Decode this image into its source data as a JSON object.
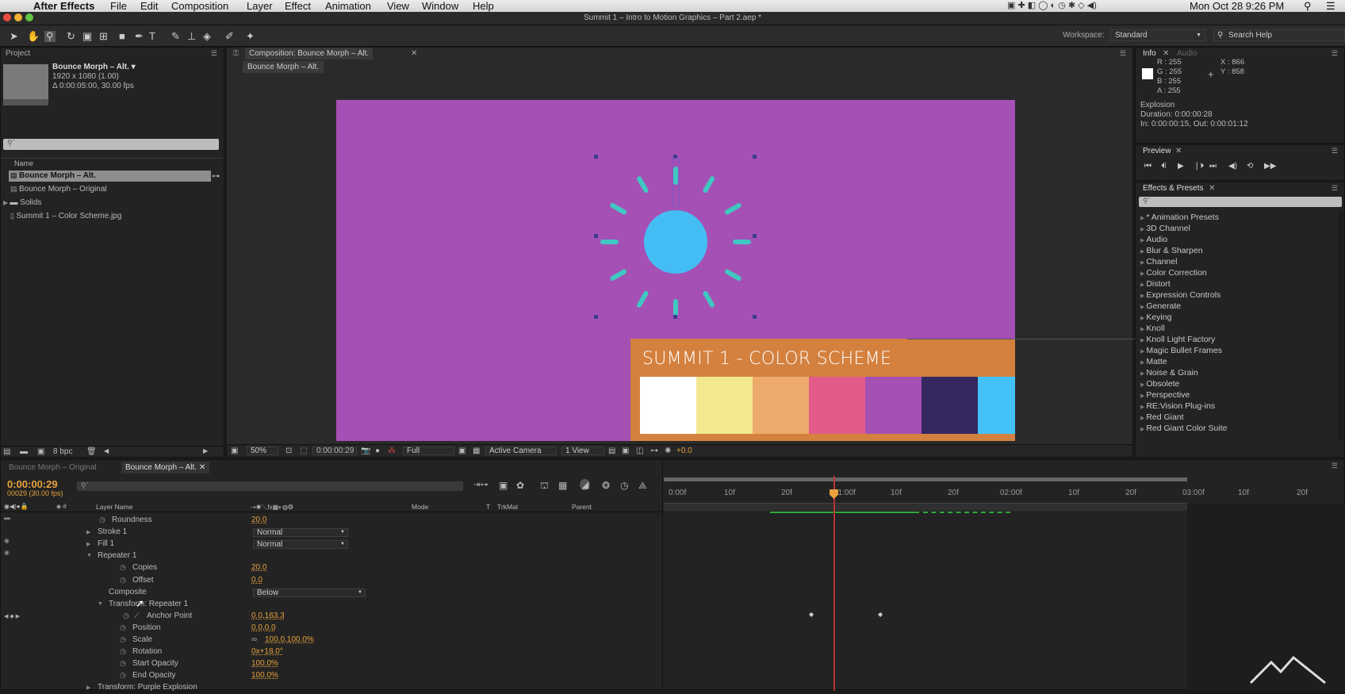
{
  "menubar": {
    "app_name": "After Effects",
    "items": [
      "File",
      "Edit",
      "Composition",
      "Layer",
      "Effect",
      "Animation",
      "View",
      "Window",
      "Help"
    ],
    "clock": "Mon Oct 28  9:26 PM"
  },
  "window_title": "Summit 1 – Intro to Motion Graphics – Part 2.aep *",
  "toolbar": {
    "workspace_label": "Workspace:",
    "workspace_value": "Standard",
    "search_help": "Search Help"
  },
  "project": {
    "tab": "Project",
    "comp_name": "Bounce Morph – Alt. ▾",
    "comp_res": "1920 x 1080 (1.00)",
    "comp_dur": "Δ 0:00:05:00, 30.00 fps",
    "search_placeholder": "⚲ˇ",
    "col_name": "Name",
    "items": [
      {
        "label": "Bounce Morph – Alt.",
        "icon": "composition-icon"
      },
      {
        "label": "Bounce Morph – Original",
        "icon": "composition-icon"
      },
      {
        "label": "Solids",
        "icon": "folder-icon"
      },
      {
        "label": "Summit 1 – Color Scheme.jpg",
        "icon": "image-file-icon"
      }
    ],
    "bpc": "8 bpc"
  },
  "composition": {
    "tab": "Composition: Bounce Morph – Alt.",
    "sub_tab": "Bounce Morph – Alt.",
    "bg_color": "#a550b5",
    "zoom": "50%",
    "timecode": "0:00:00:29",
    "resolution": "Full",
    "camera": "Active Camera",
    "view": "1 View",
    "exposure": "+0.0",
    "palette_title": "SUMMIT 1 - COLOR SCHEME",
    "palette_bar_color": "#d4813f",
    "palette": [
      "#ffffff",
      "#f2e88f",
      "#eeaa6a",
      "#e25b88",
      "#a450b4",
      "#34285e",
      "#44c2f8"
    ],
    "burst_color": "#41c7c2",
    "sun_color": "#44bdf5"
  },
  "info": {
    "tab": "Info",
    "tab2": "Audio",
    "r": "R : 255",
    "g": "G : 255",
    "b": "B : 255",
    "a": "A : 255",
    "x": "X : 866",
    "y": "Y : 858",
    "layer": "Explosion",
    "duration": "Duration: 0:00:00:28",
    "in_out": "In: 0:00:00:15, Out: 0:00:01:12"
  },
  "preview": {
    "tab": "Preview"
  },
  "effects": {
    "tab": "Effects & Presets",
    "search": "⚲ˇ",
    "items": [
      "* Animation Presets",
      "3D Channel",
      "Audio",
      "Blur & Sharpen",
      "Channel",
      "Color Correction",
      "Distort",
      "Expression Controls",
      "Generate",
      "Keying",
      "Knoll",
      "Knoll Light Factory",
      "Magic Bullet Frames",
      "Matte",
      "Noise & Grain",
      "Obsolete",
      "Perspective",
      "RE:Vision Plug-ins",
      "Red Giant",
      "Red Giant Color Suite"
    ]
  },
  "timeline": {
    "tabs": [
      "Bounce Morph – Original",
      "Bounce Morph – Alt."
    ],
    "timecode": "0:00:00:29",
    "frame_fps": "00029 (30.00 fps)",
    "search": "⚲ˇ",
    "columns": {
      "layer_name": "Layer Name",
      "mode": "Mode",
      "t": "T",
      "trkmat": "TrkMat",
      "parent": "Parent"
    },
    "ruler": [
      "0:00f",
      "10f",
      "20f",
      "01:00f",
      "10f",
      "20f",
      "02:00f",
      "10f",
      "20f",
      "03:00f",
      "10f",
      "20f"
    ],
    "rows": [
      {
        "label": "Roundness",
        "value": "20.0"
      },
      {
        "label": "Stroke 1",
        "value": "Normal"
      },
      {
        "label": "Fill 1",
        "value": "Normal"
      },
      {
        "label": "Repeater 1",
        "value": ""
      },
      {
        "label": "Copies",
        "value": "20.0"
      },
      {
        "label": "Offset",
        "value": "0.0"
      },
      {
        "label": "Composite",
        "value": "Below"
      },
      {
        "label": "Transform: Repeater 1",
        "value": ""
      },
      {
        "label": "Anchor Point",
        "value": "0.0,163.3"
      },
      {
        "label": "Position",
        "value": "0.0,0.0"
      },
      {
        "label": "Scale",
        "value": "100.0,100.0%"
      },
      {
        "label": "Rotation",
        "value": "0x+18.0°"
      },
      {
        "label": "Start Opacity",
        "value": "100.0%"
      },
      {
        "label": "End Opacity",
        "value": "100.0%"
      },
      {
        "label": "Transform: Purple Explosion",
        "value": ""
      }
    ]
  }
}
